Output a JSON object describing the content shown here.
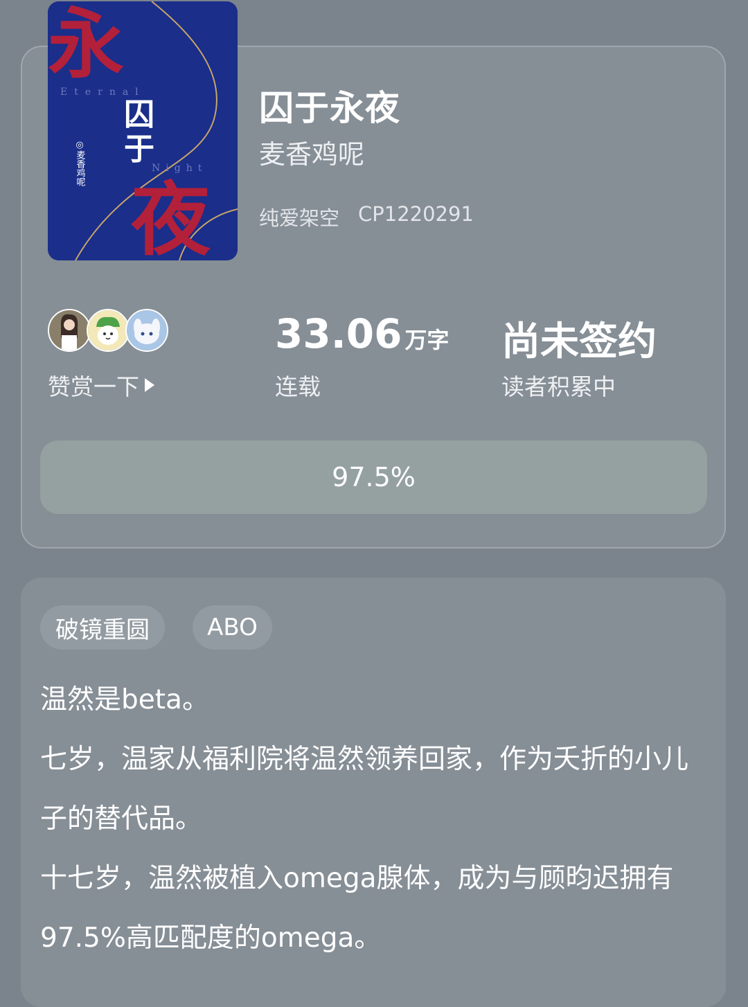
{
  "book": {
    "title": "囚于永夜",
    "author": "麦香鸡呢",
    "genre": "纯爱架空",
    "code": "CP1220291",
    "cover": {
      "big_char_top": "永",
      "small_chars": "囚于",
      "big_char_bottom": "夜",
      "en_top": "Eternal",
      "en_bottom": "Night",
      "author_vertical": "◎麦香鸡呢",
      "bg_color": "#1a2e8a",
      "char_color": "#b3203a"
    }
  },
  "stats": {
    "tip_label": "赞赏一下",
    "word_count_value": "33.06",
    "word_count_unit": "万字",
    "status": "连载",
    "contract": "尚未签约",
    "contract_status": "读者积累中"
  },
  "avatars": [
    {
      "icon": "avatar-girl-icon"
    },
    {
      "icon": "avatar-cabbage-icon"
    },
    {
      "icon": "avatar-bunny-icon"
    }
  ],
  "progress": {
    "text": "97.5%",
    "fraction": 0.975
  },
  "tags": [
    "破镜重圆",
    "ABO"
  ],
  "description": [
    "温然是beta。",
    "七岁，温家从福利院将温然领养回家，作为夭折的小儿子的替代品。",
    "十七岁，温然被植入omega腺体，成为与顾昀迟拥有97.5%高匹配度的omega。"
  ],
  "colors": {
    "background": "#7b848d",
    "card": "#868e96",
    "progress_track": "#95a0a1",
    "tag_bg": "#939ba2"
  }
}
